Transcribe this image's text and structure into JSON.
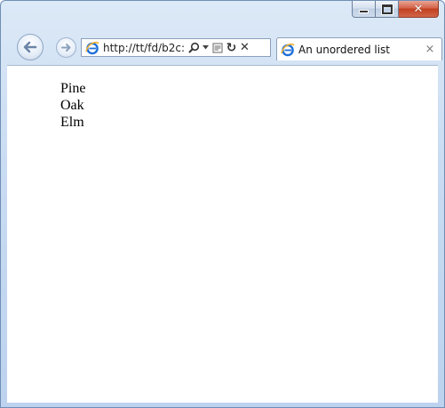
{
  "window": {
    "caption_buttons": [
      "minimize",
      "maximize",
      "close"
    ],
    "close_glyph": "✕"
  },
  "navigation": {
    "address_url": "http://tt/fd/b2c:",
    "back_icon": "back-arrow-icon",
    "forward_icon": "forward-arrow-icon",
    "search_icon": "search-icon",
    "compat_icon": "compatibility-view-icon",
    "refresh_glyph": "↻",
    "stop_glyph": "✕"
  },
  "tab": {
    "title": "An unordered list",
    "close_glyph": "×"
  },
  "page": {
    "items": [
      "Pine",
      "Oak",
      "Elm"
    ]
  },
  "colors": {
    "frame": "#c9dcf2",
    "close_button": "#c1401f",
    "ie_blue": "#1e6fd9",
    "ie_orange": "#f2b233"
  }
}
